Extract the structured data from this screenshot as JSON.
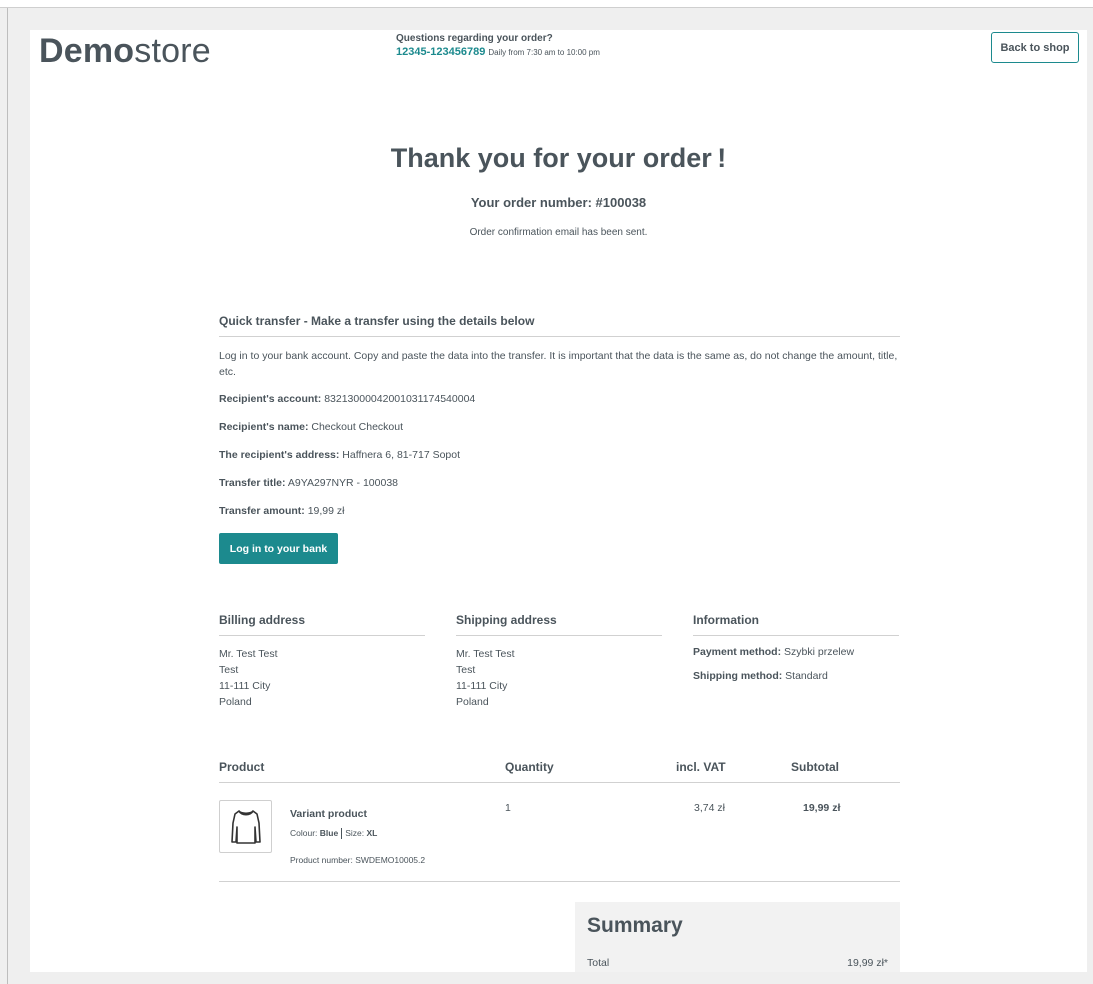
{
  "header": {
    "logo_bold": "Demo",
    "logo_light": "store",
    "question": "Questions regarding your order?",
    "phone": "12345-123456789",
    "hours": "Daily from 7:30 am to 10:00 pm",
    "back_label": "Back to shop"
  },
  "hero": {
    "title": "Thank you for your order !",
    "order_number": "Your order number: #100038",
    "confirmation": "Order confirmation email has been sent."
  },
  "transfer": {
    "title": "Quick transfer - Make a transfer using the details below",
    "description": "Log in to your bank account. Copy and paste the data into the transfer. It is important that the data is the same as, do not change the amount, title, etc.",
    "account_label": "Recipient's account:",
    "account_value": "83213000042001031174540004",
    "name_label": "Recipient's name:",
    "name_value": " Checkout Checkout",
    "address_label": "The recipient's address:",
    "address_value": "Haffnera 6, 81-717 Sopot",
    "title_label": "Transfer title:",
    "title_value": "A9YA297NYR - 100038",
    "amount_label": "Transfer amount:",
    "amount_value": "19,99 zł",
    "bank_button": "Log in to your bank"
  },
  "billing": {
    "heading": "Billing address",
    "line1": "Mr. Test Test",
    "line2": "Test",
    "line3": "11-111 City",
    "line4": "Poland"
  },
  "shipping": {
    "heading": "Shipping address",
    "line1": "Mr. Test Test",
    "line2": "Test",
    "line3": "11-111 City",
    "line4": "Poland"
  },
  "information": {
    "heading": "Information",
    "payment_label": "Payment method:",
    "payment_value": "Szybki przelew",
    "shipping_label": "Shipping method:",
    "shipping_value": "Standard"
  },
  "table": {
    "headers": {
      "product": "Product",
      "quantity": "Quantity",
      "vat": "incl. VAT",
      "subtotal": "Subtotal"
    },
    "row": {
      "name": "Variant product",
      "colour_label": "Colour:",
      "colour_value": "Blue",
      "size_label": "Size:",
      "size_value": "XL",
      "product_number": "Product number: SWDEMO10005.2",
      "quantity": "1",
      "vat": "3,74 zł",
      "subtotal": "19,99 zł",
      "icon": "longsleeve-shirt-icon"
    }
  },
  "summary": {
    "heading": "Summary",
    "total_label": "Total",
    "total_value": "19,99 zł*"
  },
  "colors": {
    "accent": "#1c8a8e",
    "text": "#4a545b",
    "border": "#d1d1d1",
    "summary_bg": "#f2f2f2"
  }
}
